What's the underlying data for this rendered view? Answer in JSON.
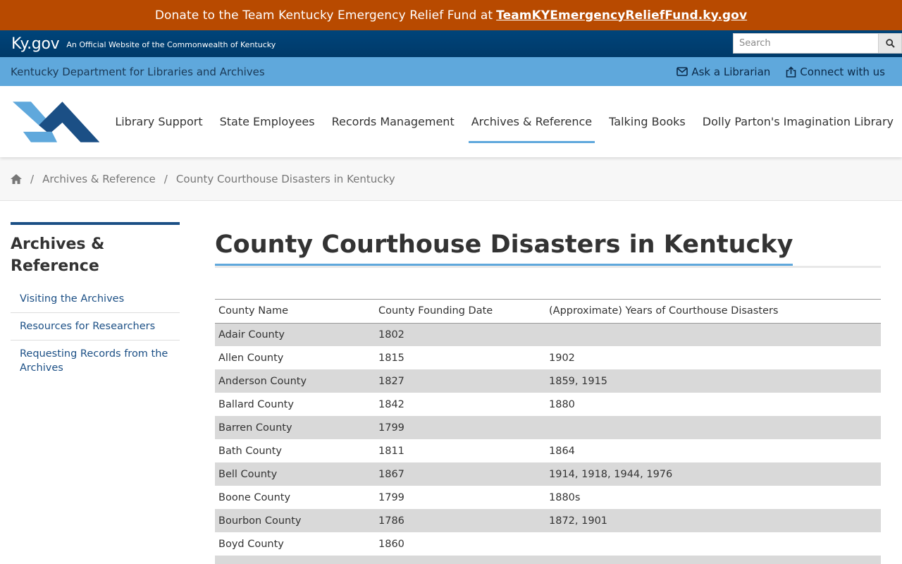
{
  "donate": {
    "text": "Donate to the Team Kentucky Emergency Relief Fund at",
    "link": "TeamKYEmergencyReliefFund.ky.gov"
  },
  "kygov": {
    "logo": "Ky.gov",
    "official": "An Official Website of the Commonwealth of Kentucky",
    "search_placeholder": "Search"
  },
  "agency": {
    "name": "Kentucky Department for Libraries and Archives",
    "ask": "Ask a Librarian",
    "connect": "Connect with us"
  },
  "nav": {
    "items": [
      "Library Support",
      "State Employees",
      "Records Management",
      "Archives & Reference",
      "Talking Books",
      "Dolly Parton's Imagination Library"
    ],
    "active": "Archives & Reference"
  },
  "breadcrumb": {
    "section": "Archives & Reference",
    "current": "County Courthouse Disasters in Kentucky"
  },
  "sidebar": {
    "title": "Archives & Reference",
    "items": [
      "Visiting the Archives",
      "Resources for Researchers",
      "Requesting Records from the Archives"
    ]
  },
  "page": {
    "title": "County Courthouse Disasters in Kentucky"
  },
  "table": {
    "headers": [
      "County Name",
      "County Founding Date",
      "(Approximate) Years of Courthouse Disasters"
    ],
    "rows": [
      [
        "Adair County",
        "1802",
        ""
      ],
      [
        "Allen County",
        "1815",
        "1902"
      ],
      [
        "Anderson County",
        "1827",
        "1859, 1915"
      ],
      [
        "Ballard County",
        "1842",
        "1880"
      ],
      [
        "Barren County",
        "1799",
        ""
      ],
      [
        "Bath County",
        "1811",
        "1864"
      ],
      [
        "Bell County",
        "1867",
        "1914, 1918, 1944, 1976"
      ],
      [
        "Boone County",
        "1799",
        "1880s"
      ],
      [
        "Bourbon County",
        "1786",
        "1872, 1901"
      ],
      [
        "Boyd County",
        "1860",
        ""
      ],
      [
        "",
        "",
        ""
      ]
    ]
  },
  "colors": {
    "donate_bg": "#b84a00",
    "kygov_bg": "#00447a",
    "agency_bg": "#5fa8dc",
    "accent": "#1b4f85"
  }
}
